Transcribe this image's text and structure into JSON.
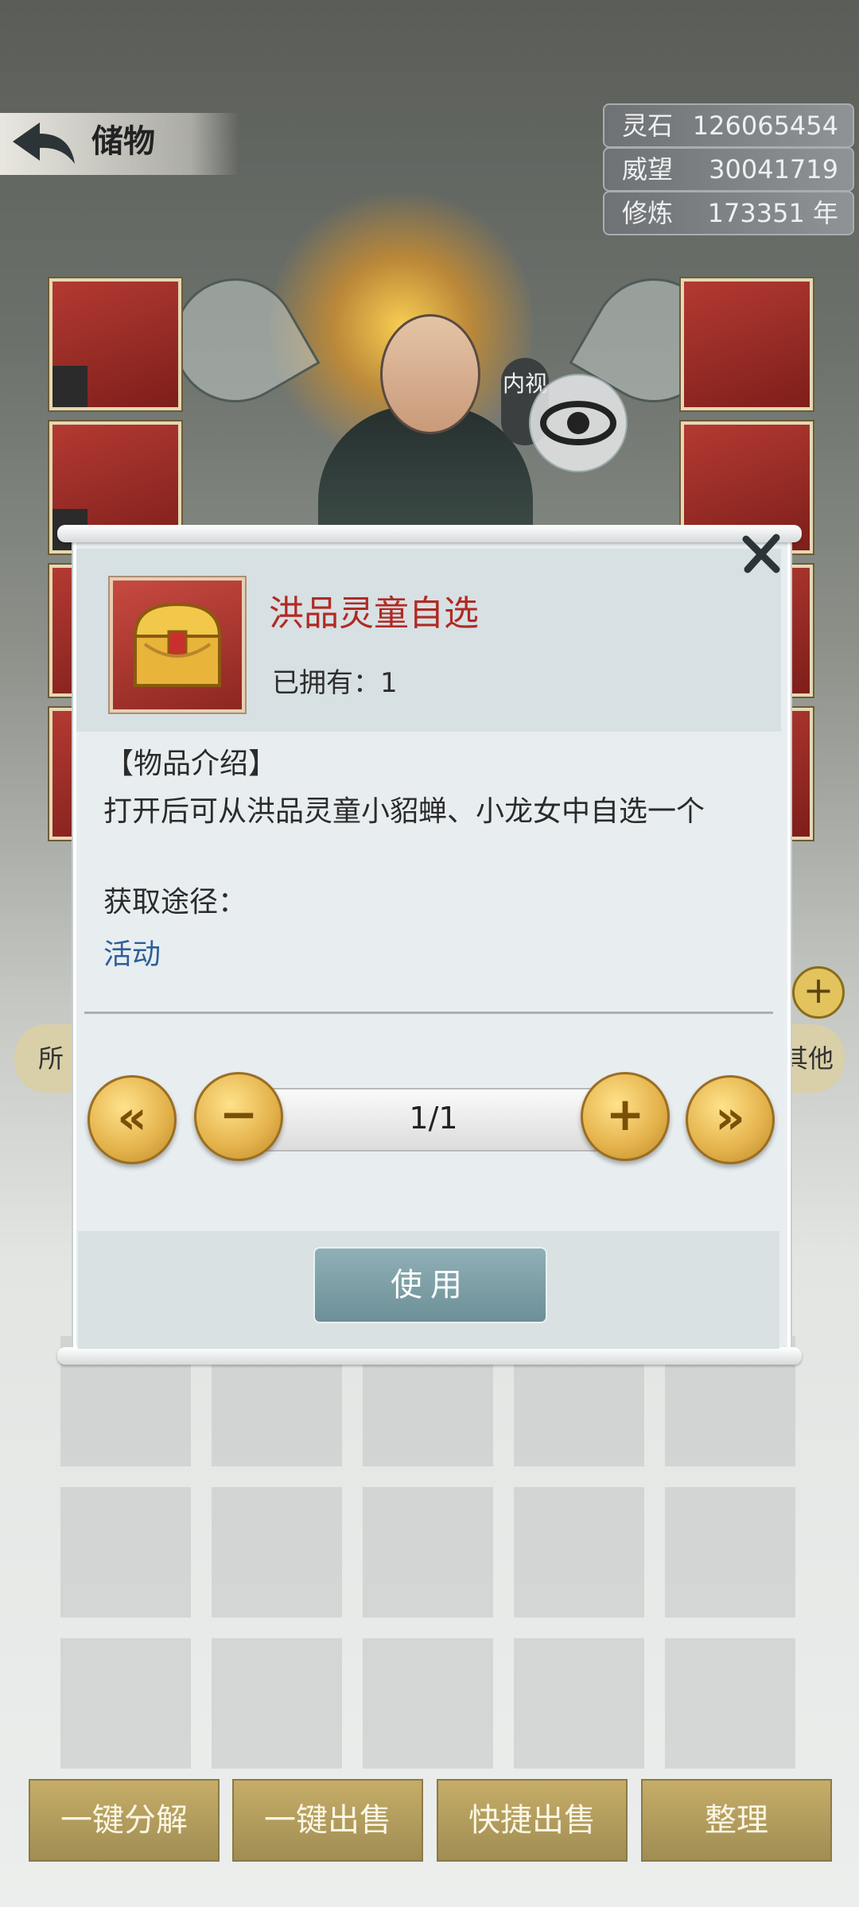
{
  "header": {
    "title": "储物"
  },
  "stats": [
    {
      "label": "灵石",
      "value": "126065454"
    },
    {
      "label": "威望",
      "value": "30041719"
    },
    {
      "label": "修炼",
      "value": "173351 年"
    }
  ],
  "character": {
    "inner_view_label": "内视"
  },
  "background_tabs": {
    "left_partial": "所",
    "right_partial": "其他"
  },
  "modal": {
    "item_name": "洪品灵童自选",
    "owned_label": "已拥有：1",
    "desc_title": "【物品介绍】",
    "desc_text": "打开后可从洪品灵童小貂蝉、小龙女中自选一个",
    "source_title": "获取途径：",
    "source_value": "活动",
    "quantity": "1/1",
    "use_button": "使用",
    "controls": {
      "first": "«",
      "minus": "−",
      "plus": "+",
      "last": "»"
    }
  },
  "bottom_buttons": [
    "一键分解",
    "一键出售",
    "快捷出售",
    "整理"
  ],
  "colors": {
    "item_name": "#b12a24",
    "link": "#2e5f99",
    "gold": "#e3b14a"
  }
}
